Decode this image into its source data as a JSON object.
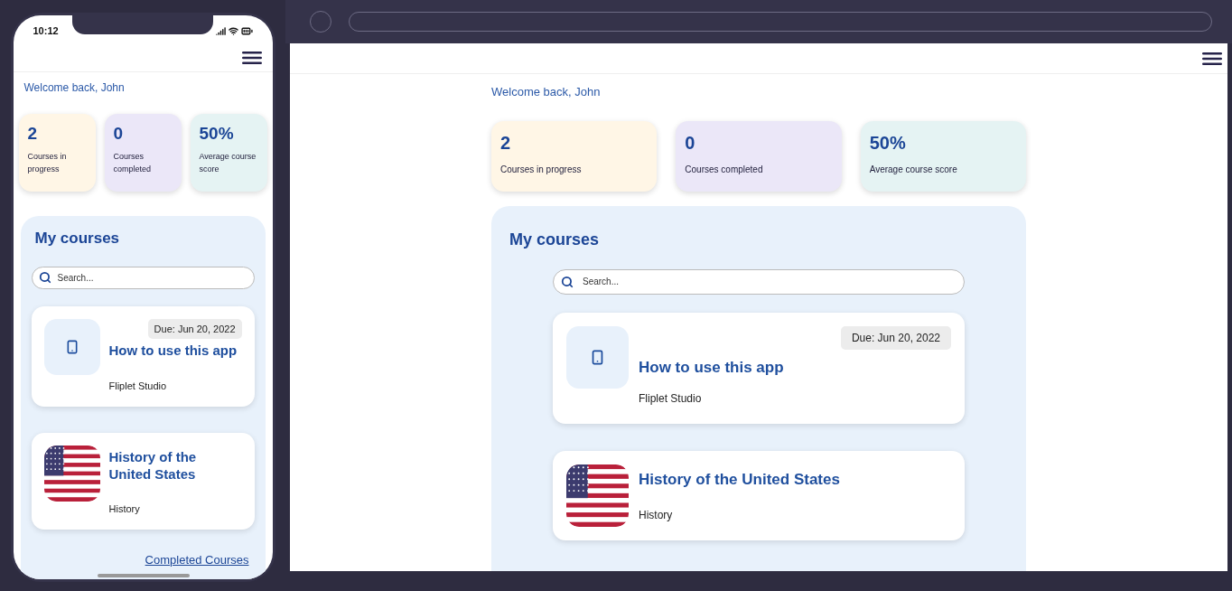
{
  "phone": {
    "status_time": "10:12",
    "welcome": "Welcome back, John",
    "stats": [
      {
        "value": "2",
        "label": "Courses in progress",
        "color": "#fff6e6"
      },
      {
        "value": "0",
        "label": "Courses completed",
        "color": "#ebe7f8"
      },
      {
        "value": "50%",
        "label": "Average course score",
        "color": "#e5f3f3"
      }
    ],
    "section_title": "My courses",
    "search": {
      "placeholder": "Search..."
    },
    "courses": [
      {
        "kind": "device",
        "due": "Due: Jun 20, 2022",
        "title": "How to use this app",
        "subtitle": "Fliplet Studio"
      },
      {
        "kind": "flag",
        "title": "History of the United States",
        "subtitle": "History"
      }
    ],
    "completed_link": "Completed Courses"
  },
  "browser": {
    "welcome": "Welcome back, John",
    "stats": [
      {
        "value": "2",
        "label": "Courses in progress",
        "color": "#fff6e6"
      },
      {
        "value": "0",
        "label": "Courses completed",
        "color": "#ebe7f8"
      },
      {
        "value": "50%",
        "label": "Average course score",
        "color": "#e5f3f3"
      }
    ],
    "section_title": "My courses",
    "search": {
      "placeholder": "Search..."
    },
    "courses": [
      {
        "kind": "device",
        "due": "Due: Jun 20, 2022",
        "title": "How to use this app",
        "subtitle": "Fliplet Studio"
      },
      {
        "kind": "flag",
        "title": "History of the United States",
        "subtitle": "History"
      }
    ]
  }
}
